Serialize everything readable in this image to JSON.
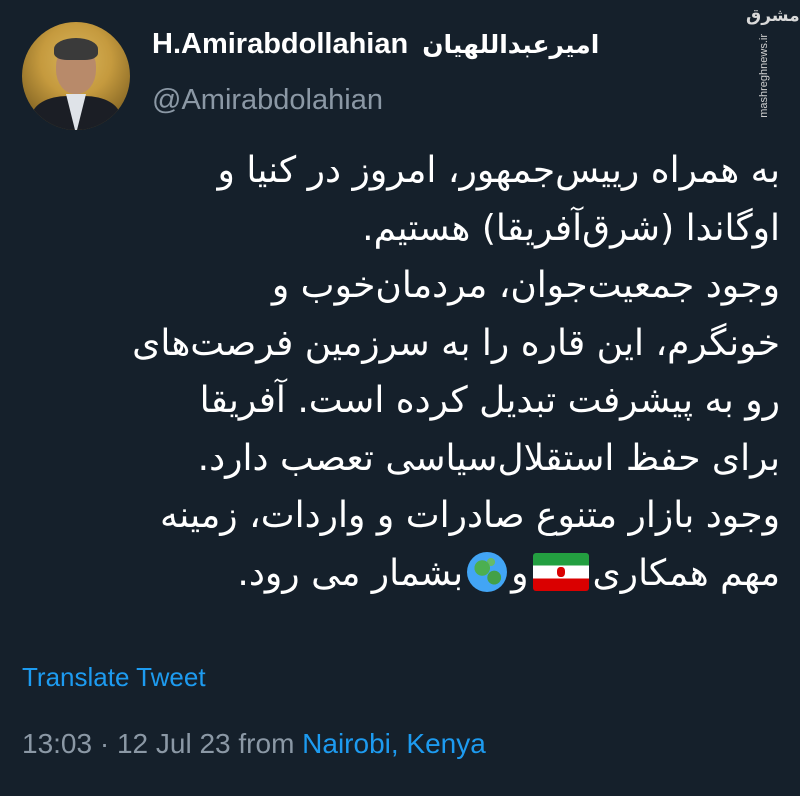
{
  "tweet": {
    "display_name": "H.Amirabdollahian",
    "display_name_fa": "امیرعبداللهیان",
    "handle": "@Amirabdolahian",
    "body_lines": [
      "به همراه رییس‌جمهور، امروز در کنیا و",
      "اوگاندا (شرق‌آفریقا) هستیم.",
      "وجود جمعیت‌جوان، مردمان‌خوب و",
      "خونگرم، این قاره را به سرزمین فرصت‌های",
      "رو به پیشرفت تبدیل کرده است. آفریقا",
      "برای حفظ استقلال‌سیاسی تعصب دارد.",
      "وجود بازار متنوع صادرات و واردات، زمینه"
    ],
    "last_line": {
      "before": "مهم همکاری",
      "between": "و",
      "after": "بشمار می رود."
    },
    "icons": [
      "iran-flag-icon",
      "globe-icon"
    ],
    "translate_label": "Translate Tweet",
    "time": "13:03",
    "separator": "·",
    "date": "12 Jul 23",
    "from_label": "from",
    "location": "Nairobi, Kenya"
  },
  "watermark": {
    "logo": "مشرق",
    "url": "mashreghnews.ir"
  },
  "colors": {
    "background": "#15202b",
    "text": "#ffffff",
    "secondary": "#8b98a5",
    "link": "#1d9bf0"
  }
}
